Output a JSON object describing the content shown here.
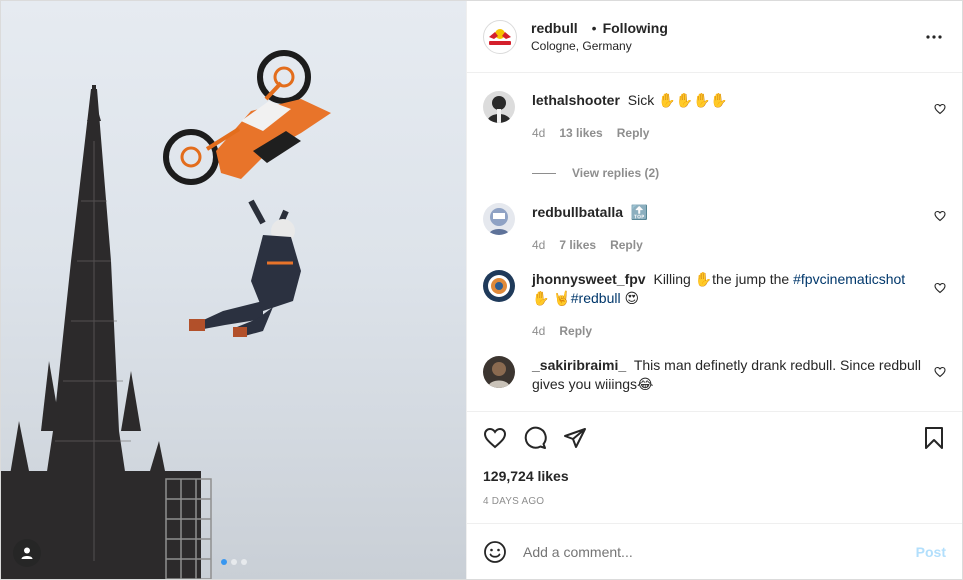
{
  "header": {
    "username": "redbull",
    "bullet": "•",
    "follow_label": "Following",
    "location": "Cologne, Germany"
  },
  "comments": [
    {
      "username": "lethalshooter",
      "text": "Sick ✋✋✋✋",
      "age": "4d",
      "likes": "13 likes",
      "reply": "Reply",
      "view_replies": "View replies (2)"
    },
    {
      "username": "redbullbatalla",
      "text": "🔝",
      "age": "4d",
      "likes": "7 likes",
      "reply": "Reply"
    },
    {
      "username": "jhonnysweet_fpv",
      "text_before": "Killing ✋the jump the ",
      "hashtag1": "#fpvcinematicshot",
      "text_mid": " ✋ 🤘",
      "hashtag2": "#redbull",
      "text_after": " 😍",
      "age": "4d",
      "reply": "Reply"
    },
    {
      "username": "_sakiribraimi_",
      "text": "This man definetly drank redbull. Since redbull gives you wiiings😂"
    }
  ],
  "likes_count": "129,724 likes",
  "date": "4 DAYS AGO",
  "add_comment": {
    "placeholder": "Add a comment...",
    "post_label": "Post"
  },
  "carousel": {
    "total": 3,
    "active": 1
  },
  "colors": {
    "accent": "#3897f0",
    "hashtag": "#00376b",
    "muted": "#8e8e8e",
    "post_disabled": "#b2dffc"
  },
  "icons": [
    "user-tag-icon",
    "more-options-icon",
    "heart-icon",
    "comment-icon",
    "share-icon",
    "bookmark-icon",
    "emoji-icon"
  ]
}
